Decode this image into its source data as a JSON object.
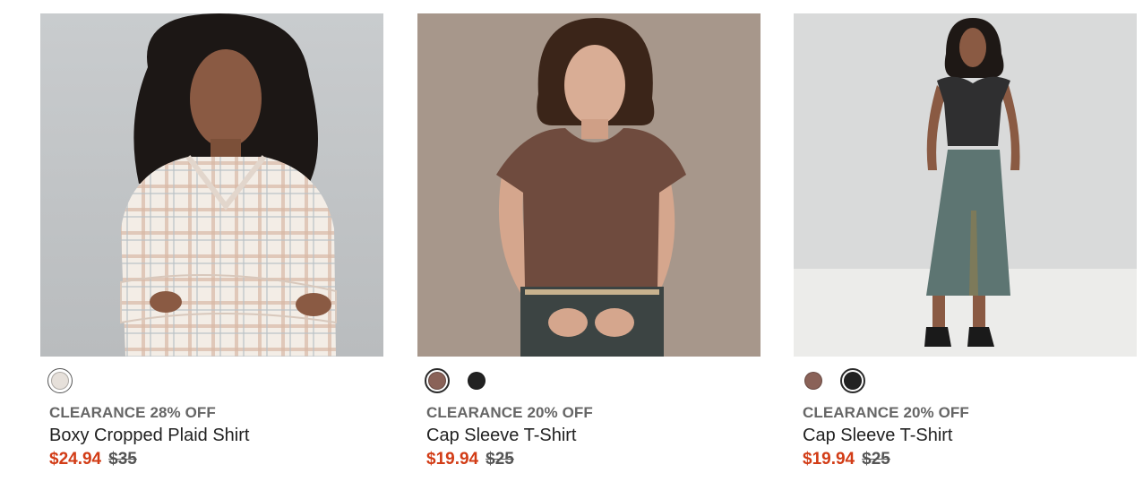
{
  "products": [
    {
      "badge": "CLEARANCE 28% OFF",
      "title": "Boxy Cropped Plaid Shirt",
      "sale_price": "$24.94",
      "original_price": "$35",
      "swatches": [
        {
          "color": "#e6e0da",
          "selected": true
        }
      ]
    },
    {
      "badge": "CLEARANCE 20% OFF",
      "title": "Cap Sleeve T-Shirt",
      "sale_price": "$19.94",
      "original_price": "$25",
      "swatches": [
        {
          "color": "#8a6258",
          "selected": true
        },
        {
          "color": "#222222",
          "selected": false
        }
      ]
    },
    {
      "badge": "CLEARANCE 20% OFF",
      "title": "Cap Sleeve T-Shirt",
      "sale_price": "$19.94",
      "original_price": "$25",
      "swatches": [
        {
          "color": "#8a6258",
          "selected": false
        },
        {
          "color": "#222222",
          "selected": true
        }
      ]
    }
  ],
  "colors": {
    "sale": "#d23c16",
    "badge": "#666666",
    "title": "#222222"
  }
}
